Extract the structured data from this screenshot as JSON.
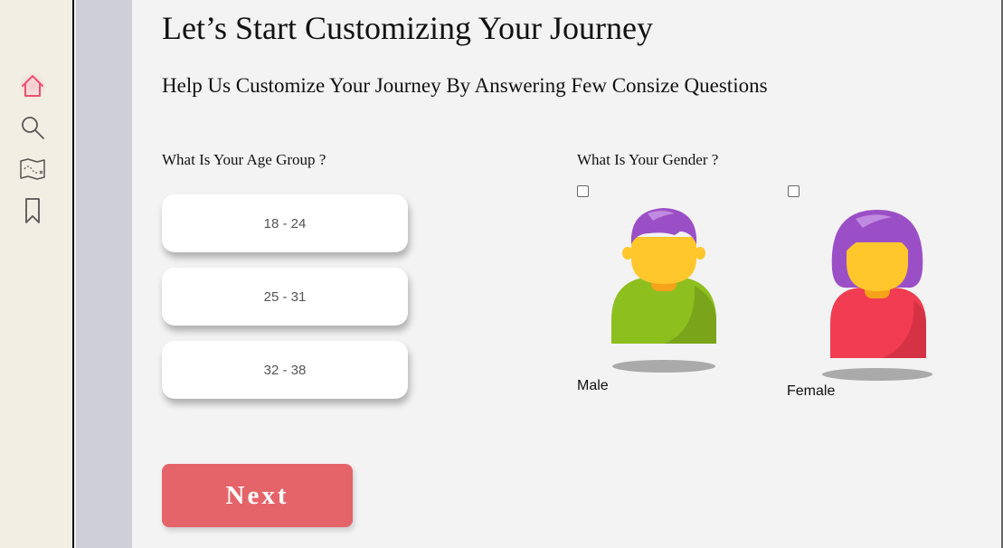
{
  "nav": {
    "items": [
      {
        "icon": "home-icon",
        "active": true
      },
      {
        "icon": "search-icon",
        "active": false
      },
      {
        "icon": "map-icon",
        "active": false
      },
      {
        "icon": "bookmark-icon",
        "active": false
      }
    ],
    "active_color": "#f0506e"
  },
  "page": {
    "title": "Let’s Start Customizing Your Journey",
    "subtitle": "Help Us Customize Your Journey By Answering Few Consize Questions"
  },
  "age_group": {
    "label": "What Is Your Age Group ?",
    "options": [
      "18 - 24",
      "25 - 31",
      "32 - 38"
    ]
  },
  "gender": {
    "label": "What Is Your Gender ?",
    "options": [
      {
        "label": "Male",
        "checked": false,
        "icon": "male-avatar-icon"
      },
      {
        "label": "Female",
        "checked": false,
        "icon": "female-avatar-icon"
      }
    ]
  },
  "next_button": {
    "label": "Next",
    "color": "#e5646a"
  }
}
